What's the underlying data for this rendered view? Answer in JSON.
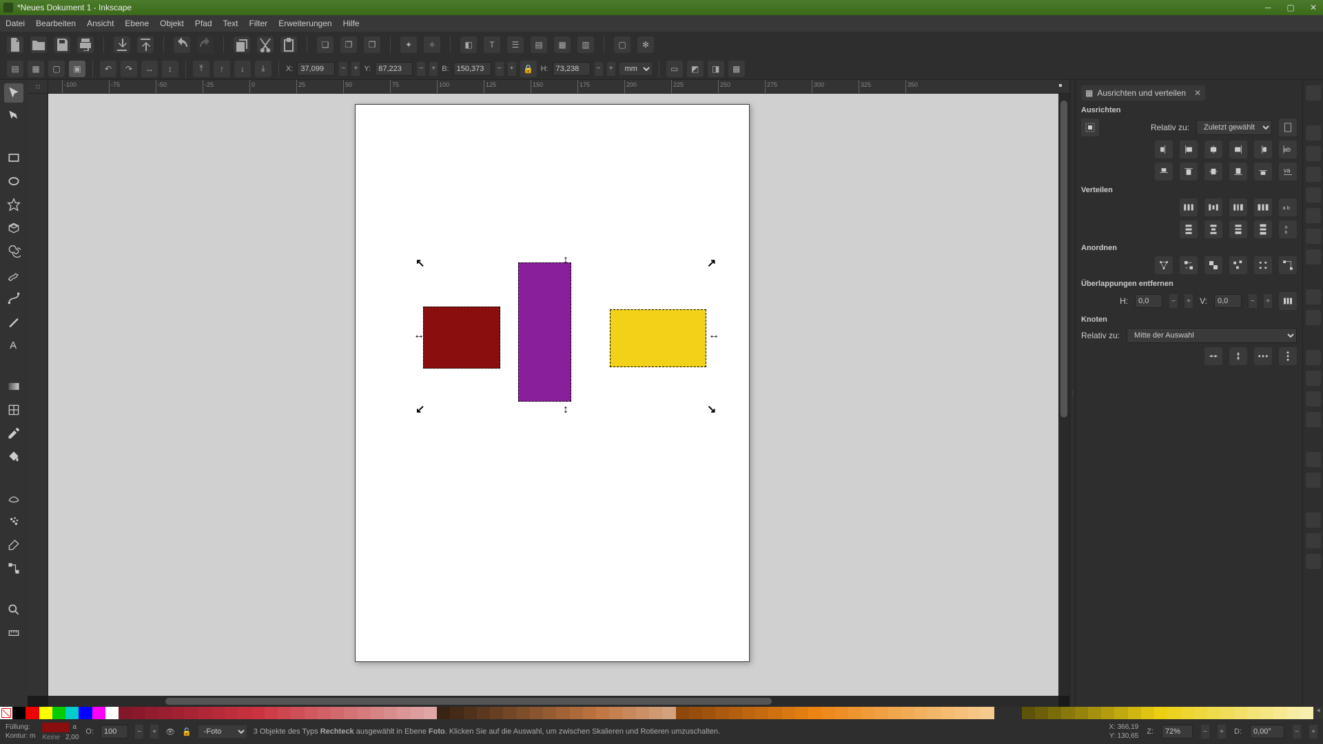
{
  "titlebar": {
    "title": "*Neues Dokument 1 - Inkscape"
  },
  "menu": {
    "datei": "Datei",
    "bearbeiten": "Bearbeiten",
    "ansicht": "Ansicht",
    "ebene": "Ebene",
    "objekt": "Objekt",
    "pfad": "Pfad",
    "text": "Text",
    "filter": "Filter",
    "erweiterungen": "Erweiterungen",
    "hilfe": "Hilfe"
  },
  "toolbar2": {
    "x_label": "X:",
    "x_value": "37,099",
    "y_label": "Y:",
    "y_value": "87,223",
    "b_label": "B:",
    "b_value": "150,373",
    "h_label": "H:",
    "h_value": "73,238",
    "unit": "mm"
  },
  "ruler": {
    "ticks": [
      "-100",
      "-75",
      "-50",
      "-25",
      "0",
      "25",
      "50",
      "75",
      "100",
      "125",
      "150",
      "175",
      "200",
      "225",
      "250",
      "275",
      "300",
      "325",
      "350"
    ]
  },
  "panel": {
    "title": "Ausrichten und verteilen",
    "section_align": "Ausrichten",
    "relativ_zu": "Relativ zu:",
    "relativ_value": "Zuletzt gewählt",
    "section_verteilen": "Verteilen",
    "section_anordnen": "Anordnen",
    "section_overlap": "Überlappungen entfernen",
    "overlap_h_label": "H:",
    "overlap_h_value": "0,0",
    "overlap_v_label": "V:",
    "overlap_v_value": "0,0",
    "section_knoten": "Knoten",
    "knoten_relativ": "Relativ zu:",
    "knoten_value": "Mitte der Auswahl"
  },
  "status": {
    "fill_label": "Füllung:",
    "fill_hint": "a",
    "stroke_label": "Kontur: m",
    "stroke_value": "Keine",
    "stroke_width": "2,00",
    "opacity_label": "O:",
    "opacity_value": "100",
    "layer": "-Foto",
    "message_prefix": "3 Objekte des Typs ",
    "message_bold": "Rechteck",
    "message_mid": " ausgewählt in Ebene ",
    "message_layer": "Foto",
    "message_suffix": ". Klicken Sie auf die Auswahl, um zwischen Skalieren und Rotieren umzuschalten.",
    "x_label": "X:",
    "x_value": "366,19",
    "y_label": "Y:",
    "y_value": "130,65",
    "z_label": "Z:",
    "z_value": "72%",
    "d_label": "D:",
    "d_value": "0,00°"
  },
  "shapes": {
    "red": {
      "color": "#8a0e0e"
    },
    "purple": {
      "color": "#8a1f9c"
    },
    "yellow": {
      "color": "#f2d219"
    }
  }
}
